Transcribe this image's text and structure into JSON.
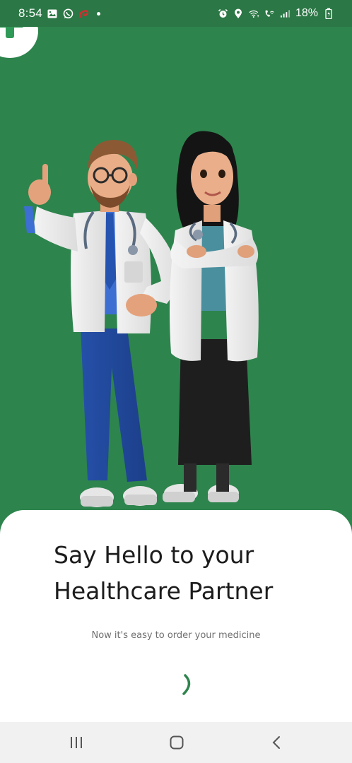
{
  "status_bar": {
    "time": "8:54",
    "battery_percent": "18%",
    "left_icons": [
      "gallery-icon",
      "whatsapp-icon",
      "airtel-icon",
      "dot-icon"
    ],
    "right_icons": [
      "alarm-icon",
      "location-icon",
      "wifi-icon",
      "call-icon",
      "signal-icon",
      "battery-icon"
    ]
  },
  "brand": {
    "primary_color": "#2e844d",
    "accent_color": "#2f9a57",
    "logo_icon": "plus-cross-logo-icon"
  },
  "illustration": {
    "icon": "doctors-illustration"
  },
  "onboarding": {
    "headline_line1": "Say Hello to your",
    "headline_line2": "Healthcare Partner",
    "subtitle": "Now it's easy to order your medicine",
    "loading_indicator": "spinner-icon"
  },
  "nav_bar": {
    "items": [
      "recent-apps-icon",
      "home-icon",
      "back-icon"
    ]
  }
}
